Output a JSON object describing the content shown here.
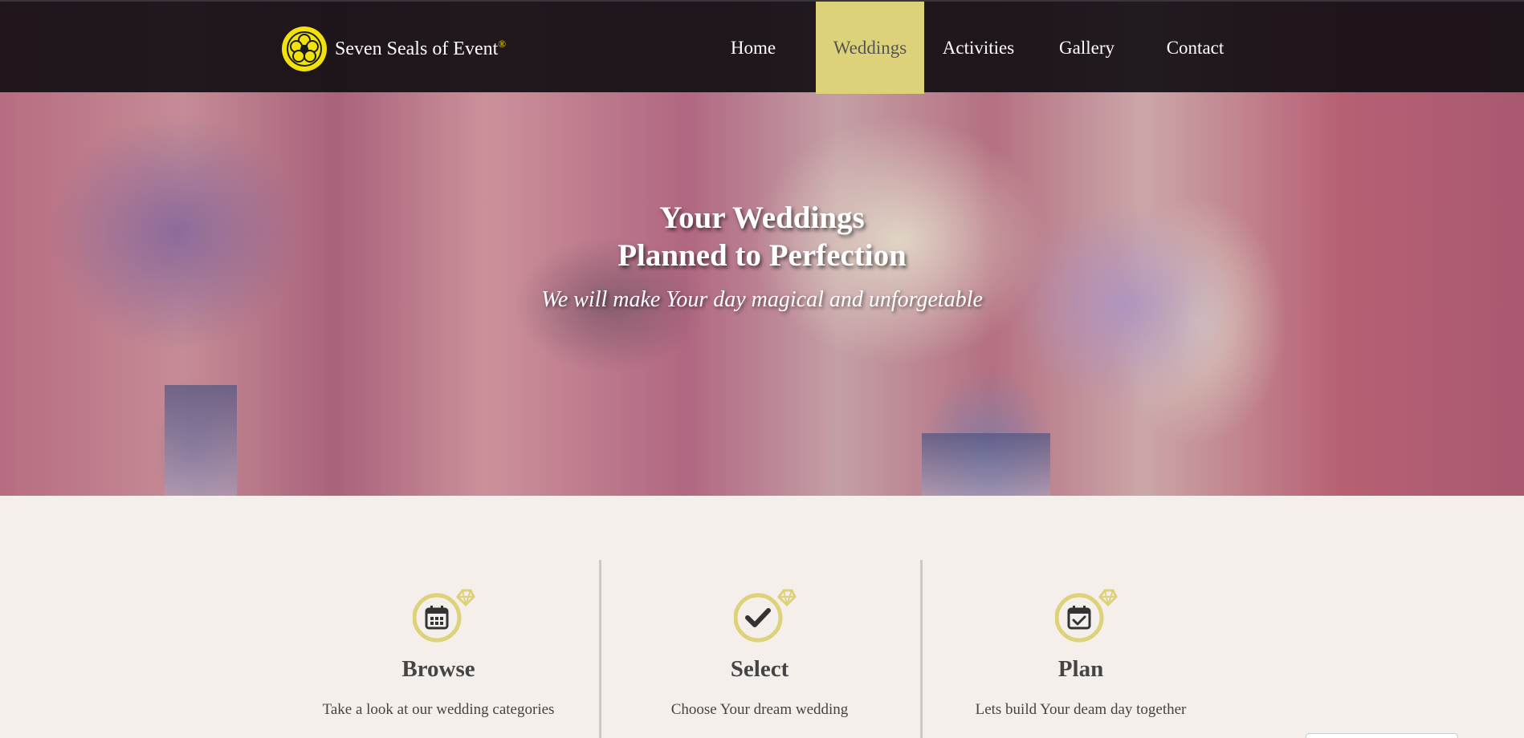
{
  "brand": {
    "name": "Seven Seals of Event",
    "registered_mark": "®",
    "logo_icon": "seal-flower-icon",
    "logo_color": "#f0e00a"
  },
  "nav": {
    "items": [
      {
        "label": "Home",
        "active": false
      },
      {
        "label": "Weddings",
        "active": true
      },
      {
        "label": "Activities",
        "active": false
      },
      {
        "label": "Gallery",
        "active": false
      },
      {
        "label": "Contact",
        "active": false
      }
    ],
    "active_color": "#ddd27a"
  },
  "hero": {
    "title_line1": "Your Weddings",
    "title_line2": "Planned to Perfection",
    "subtitle": "We will make Your day magical and unforgetable"
  },
  "features": [
    {
      "title": "Browse",
      "description": "Take a look at our wedding categories",
      "icon": "calendar-ring-icon"
    },
    {
      "title": "Select",
      "description": "Choose Your dream wedding",
      "icon": "check-ring-icon"
    },
    {
      "title": "Plan",
      "description": "Lets build Your deam day together",
      "icon": "calendar-check-ring-icon"
    }
  ],
  "colors": {
    "accent": "#ddd27a",
    "page_background": "#f5efec",
    "text": "#444444"
  }
}
